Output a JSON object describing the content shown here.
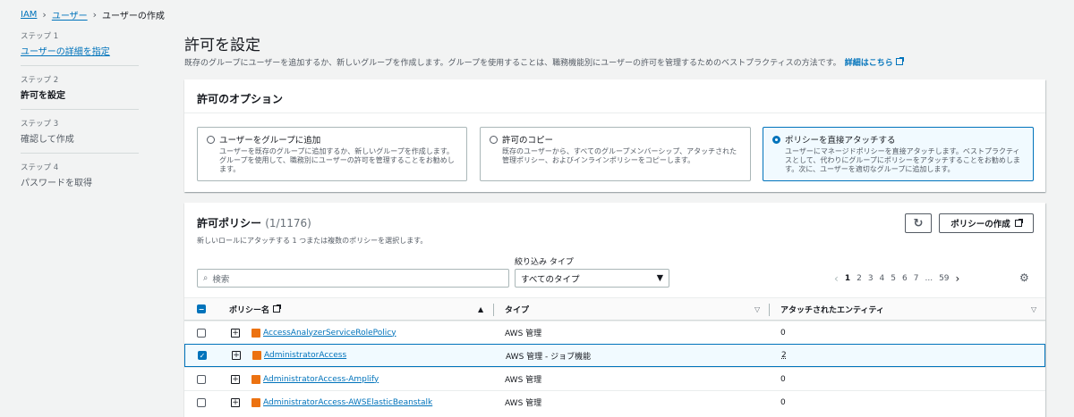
{
  "breadcrumb": {
    "root": "IAM",
    "users": "ユーザー",
    "current": "ユーザーの作成"
  },
  "steps": [
    {
      "num": "ステップ 1",
      "name": "ユーザーの詳細を指定"
    },
    {
      "num": "ステップ 2",
      "name": "許可を設定"
    },
    {
      "num": "ステップ 3",
      "name": "確認して作成"
    },
    {
      "num": "ステップ 4",
      "name": "パスワードを取得"
    }
  ],
  "page": {
    "title": "許可を設定",
    "description": "既存のグループにユーザーを追加するか、新しいグループを作成します。グループを使用することは、職務機能別にユーザーの許可を管理するためのベストプラクティスの方法です。",
    "learn_more": "詳細はこちら"
  },
  "options": {
    "heading": "許可のオプション",
    "tiles": [
      {
        "title": "ユーザーをグループに追加",
        "desc": "ユーザーを既存のグループに追加するか、新しいグループを作成します。グループを使用して、職務別にユーザーの許可を管理することをお勧めします。",
        "selected": false
      },
      {
        "title": "許可のコピー",
        "desc": "既存のユーザーから、すべてのグループメンバーシップ、アタッチされた管理ポリシー、およびインラインポリシーをコピーします。",
        "selected": false
      },
      {
        "title": "ポリシーを直接アタッチする",
        "desc": "ユーザーにマネージドポリシーを直接アタッチします。ベストプラクティスとして、代わりにグループにポリシーをアタッチすることをお勧めします。次に、ユーザーを適切なグループに追加します。",
        "selected": true
      }
    ]
  },
  "policies": {
    "title": "許可ポリシー",
    "count": "(1/1176)",
    "subtitle": "新しいロールにアタッチする 1 つまたは複数のポリシーを選択します。",
    "create_button": "ポリシーの作成",
    "filter_label": "絞り込み タイプ",
    "search_placeholder": "検索",
    "filter_value": "すべてのタイプ",
    "pages": [
      "1",
      "2",
      "3",
      "4",
      "5",
      "6",
      "7",
      "...",
      "59"
    ],
    "columns": {
      "name": "ポリシー名",
      "type": "タイプ",
      "entities": "アタッチされたエンティティ"
    },
    "rows": [
      {
        "name": "AccessAnalyzerServiceRolePolicy",
        "type": "AWS 管理",
        "entities": "0",
        "checked": false
      },
      {
        "name": "AdministratorAccess",
        "type": "AWS 管理 - ジョブ機能",
        "entities": "2",
        "checked": true
      },
      {
        "name": "AdministratorAccess-Amplify",
        "type": "AWS 管理",
        "entities": "0",
        "checked": false
      },
      {
        "name": "AdministratorAccess-AWSElasticBeanstalk",
        "type": "AWS 管理",
        "entities": "0",
        "checked": false
      }
    ]
  },
  "colors": {
    "link": "#0073bb",
    "selected_bg": "#f1faff",
    "policy_icon": "#ec7211"
  }
}
